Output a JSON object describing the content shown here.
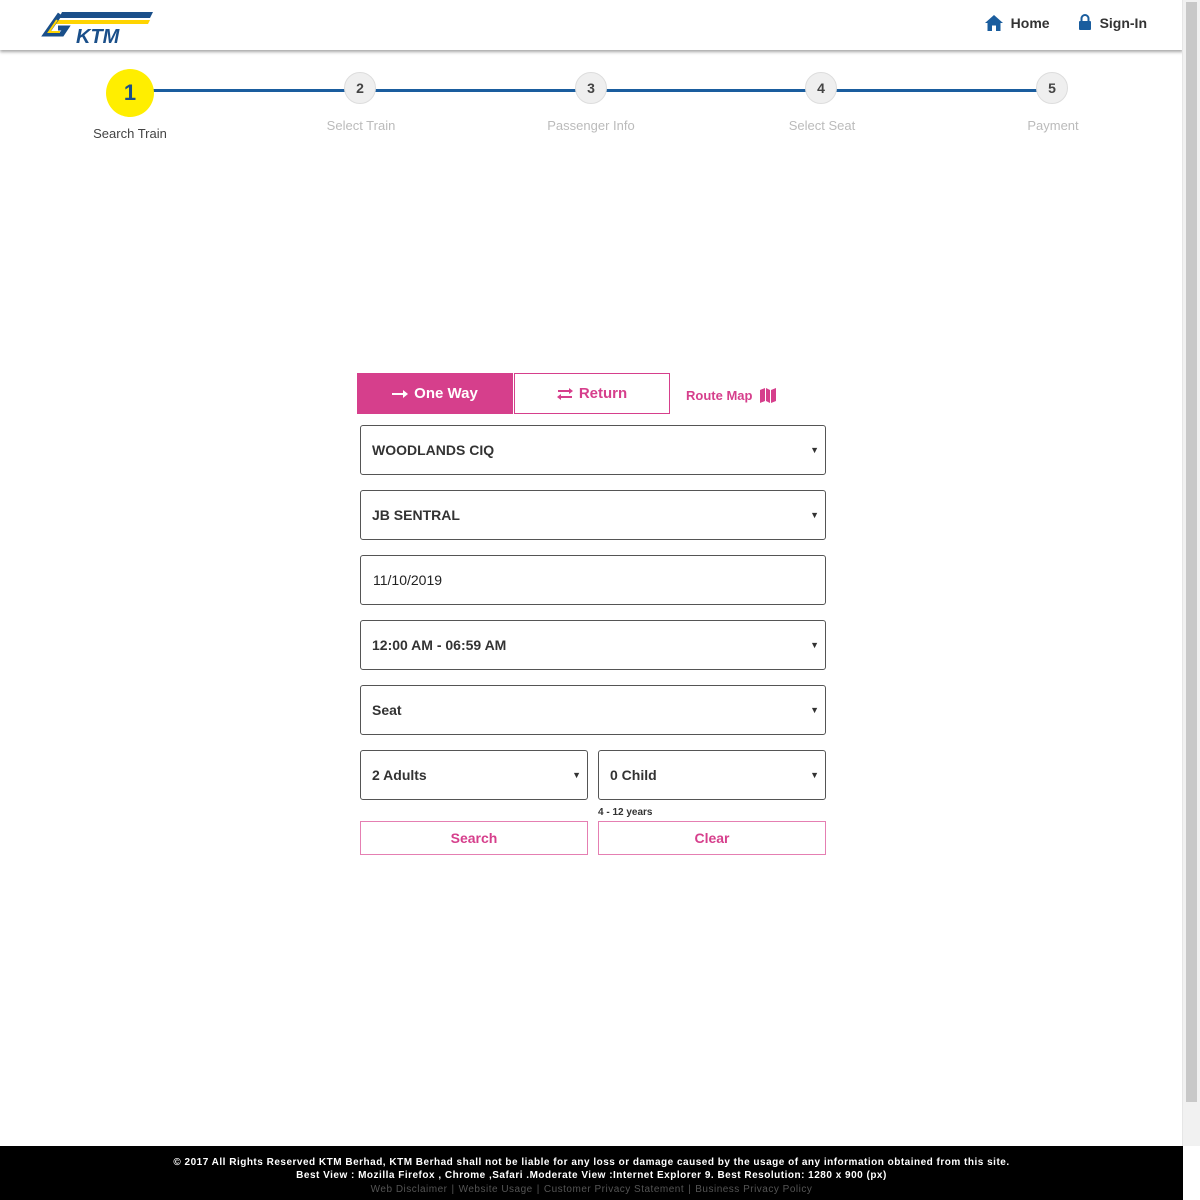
{
  "brand": {
    "logo_text": "KTM",
    "logo_blue": "#1a4f8a",
    "logo_yellow": "#ffd400"
  },
  "header": {
    "nav": [
      {
        "label": "Home",
        "icon": "home-icon"
      },
      {
        "label": "Sign-In",
        "icon": "lock-icon"
      }
    ],
    "nav_color": "#1a5d9e"
  },
  "steps": [
    {
      "number": "1",
      "label": "Search Train",
      "active": true
    },
    {
      "number": "2",
      "label": "Select Train",
      "active": false
    },
    {
      "number": "3",
      "label": "Passenger Info",
      "active": false
    },
    {
      "number": "4",
      "label": "Select Seat",
      "active": false
    },
    {
      "number": "5",
      "label": "Payment",
      "active": false
    }
  ],
  "form": {
    "trip_types": {
      "one_way": "One Way",
      "return": "Return",
      "selected": "One Way"
    },
    "route_map": "Route Map",
    "origin": "WOODLANDS CIQ",
    "destination": "JB SENTRAL",
    "date": "11/10/2019",
    "time": "12:00 AM - 06:59 AM",
    "class": "Seat",
    "adults": "2 Adults",
    "child": "0 Child",
    "child_hint": "4 - 12 years",
    "search_label": "Search",
    "clear_label": "Clear"
  },
  "footer": {
    "line1": "© 2017 All Rights Reserved KTM Berhad, KTM Berhad shall not be liable for any loss or damage caused by the usage of any information obtained from this site.",
    "line2": "Best View : Mozilla Firefox , Chrome ,Safari .Moderate View :Internet Explorer 9. Best Resolution: 1280 x 900 (px)",
    "links": [
      "Web Disclaimer",
      "Website Usage",
      "Customer Privacy Statement",
      "Business Privacy Policy"
    ],
    "link_separator": "|"
  },
  "colors": {
    "accent_pink": "#d63f8c",
    "step_active": "#ffee00",
    "step_line": "#1a5d9e"
  }
}
